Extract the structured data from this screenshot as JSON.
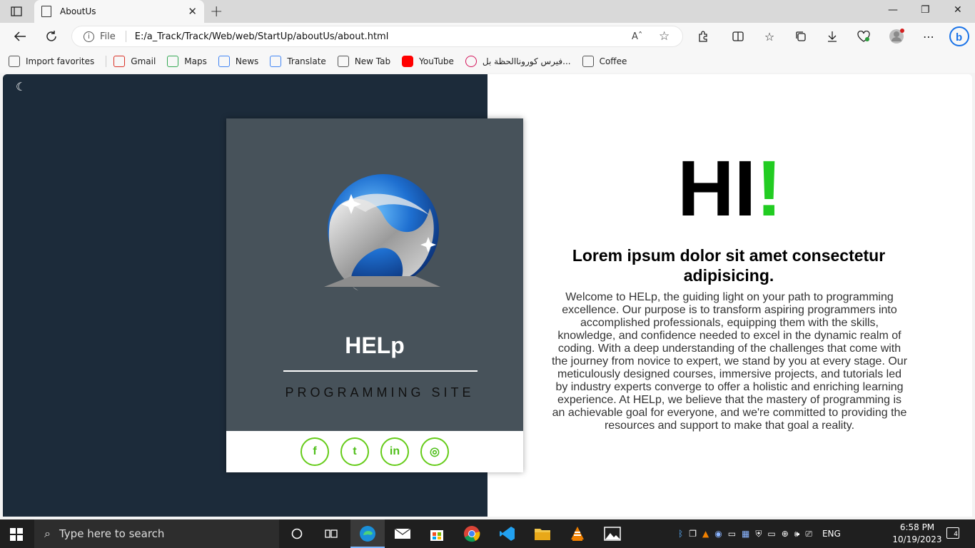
{
  "browser": {
    "tab_title": "AboutUs",
    "tab_close": "✕",
    "new_tab": "+",
    "window_controls": {
      "minimize": "—",
      "restore": "❐",
      "close": "✕"
    },
    "address": {
      "scheme_label": "File",
      "url": "E:/a_Track/Track/Web/web/StartUp/aboutUs/about.html"
    }
  },
  "favorites": [
    {
      "label": "Import favorites",
      "icon": "import-icon",
      "color": "#555555"
    },
    {
      "label": "Gmail",
      "icon": "gmail-icon",
      "color": "#d93025"
    },
    {
      "label": "Maps",
      "icon": "maps-icon",
      "color": "#34a853"
    },
    {
      "label": "News",
      "icon": "news-icon",
      "color": "#4285f4"
    },
    {
      "label": "Translate",
      "icon": "translate-icon",
      "color": "#4285f4"
    },
    {
      "label": "New Tab",
      "icon": "page-icon",
      "color": "#555555"
    },
    {
      "label": "YouTube",
      "icon": "youtube-icon",
      "color": "#ff0000"
    },
    {
      "label": "فيرس كوروناالحظة بل...",
      "icon": "target-icon",
      "color": "#d4145a"
    },
    {
      "label": "Coffee",
      "icon": "page-icon",
      "color": "#555555"
    }
  ],
  "page": {
    "theme_toggle": "☾",
    "card": {
      "title": "HELp",
      "subtitle": "PROGRAMMING SITE"
    },
    "social": [
      {
        "name": "facebook-icon",
        "glyph": "f"
      },
      {
        "name": "twitter-icon",
        "glyph": "t"
      },
      {
        "name": "linkedin-icon",
        "glyph": "in"
      },
      {
        "name": "instagram-icon",
        "glyph": "◎"
      }
    ],
    "hero": {
      "hi": "HI",
      "bang": "!"
    },
    "headline": "Lorem ipsum dolor sit amet consectetur adipisicing.",
    "body": "Welcome to HELp, the guiding light on your path to programming excellence. Our purpose is to transform aspiring programmers into accomplished professionals, equipping them with the skills, knowledge, and confidence needed to excel in the dynamic realm of coding. With a deep understanding of the challenges that come with the journey from novice to expert, we stand by you at every stage. Our meticulously designed courses, immersive projects, and tutorials led by industry experts converge to offer a holistic and enriching learning experience. At HELp, we believe that the mastery of programming is an achievable goal for everyone, and we're committed to providing the resources and support to make that goal a reality."
  },
  "taskbar": {
    "search_placeholder": "Type here to search",
    "language": "ENG",
    "time": "6:58 PM",
    "date": "10/19/2023",
    "notification_count": "4"
  }
}
